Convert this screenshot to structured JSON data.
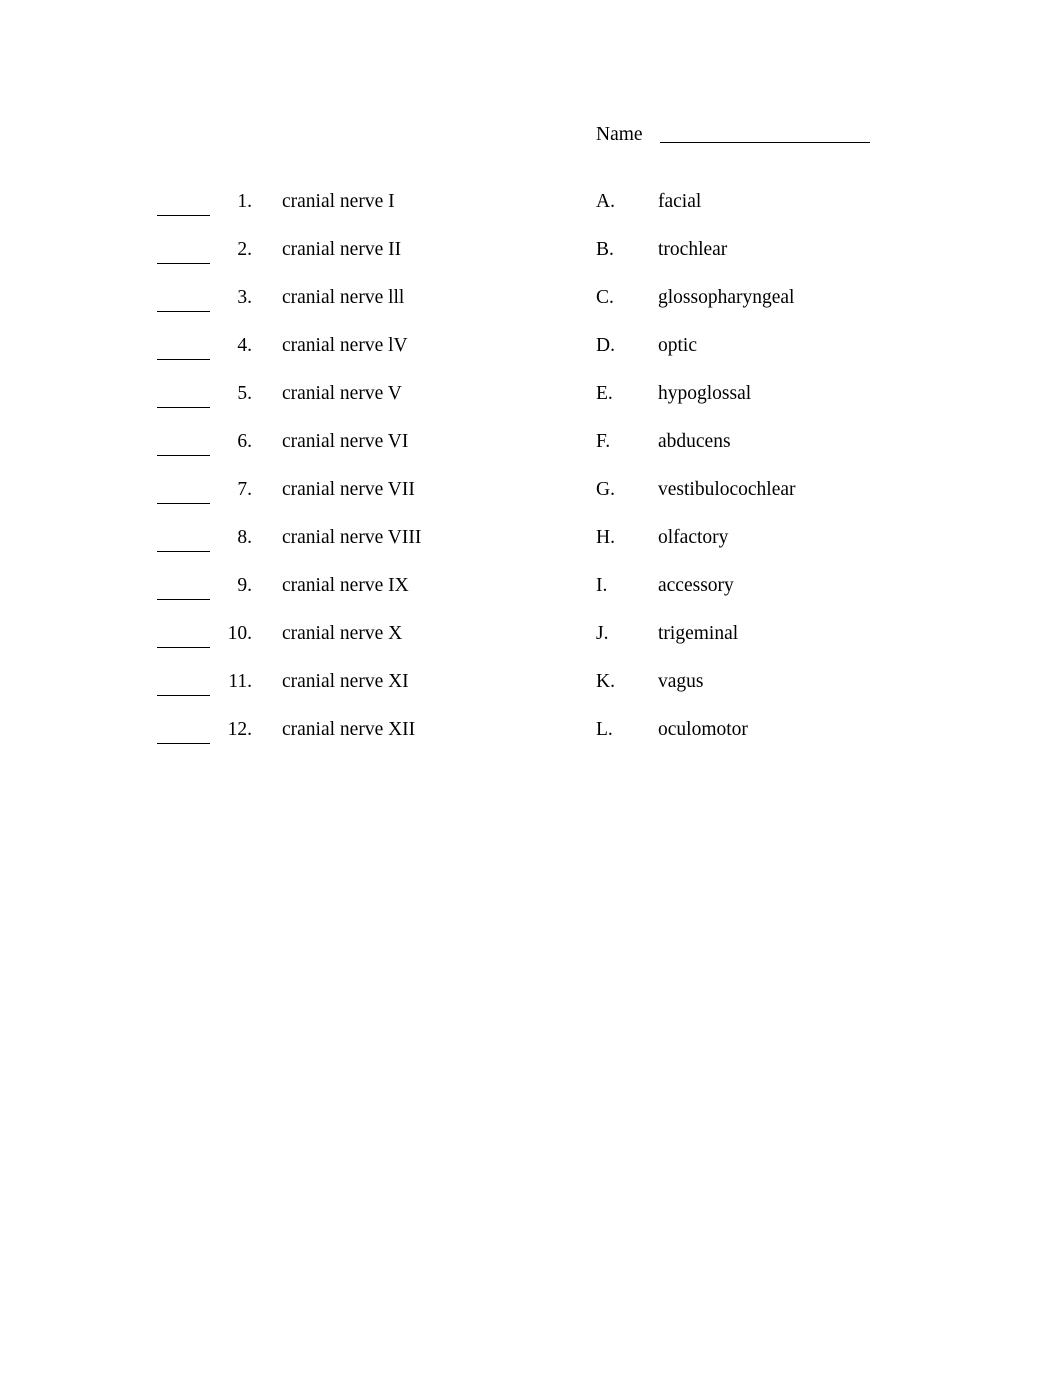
{
  "header": {
    "name_label": "Name"
  },
  "matching": {
    "items": [
      {
        "number": "1.",
        "text": "cranial nerve I"
      },
      {
        "number": "2.",
        "text": "cranial nerve II"
      },
      {
        "number": "3.",
        "text": "cranial nerve lll"
      },
      {
        "number": "4.",
        "text": "cranial nerve lV"
      },
      {
        "number": "5.",
        "text": "cranial nerve V"
      },
      {
        "number": "6.",
        "text": "cranial nerve VI"
      },
      {
        "number": "7.",
        "text": "cranial nerve VII"
      },
      {
        "number": "8.",
        "text": "cranial nerve VIII"
      },
      {
        "number": "9.",
        "text": "cranial nerve IX"
      },
      {
        "number": "10.",
        "text": "cranial nerve X"
      },
      {
        "number": "11.",
        "text": "cranial nerve XI"
      },
      {
        "number": "12.",
        "text": "cranial nerve XII"
      }
    ],
    "options": [
      {
        "letter": "A.",
        "text": "facial"
      },
      {
        "letter": "B.",
        "text": "trochlear"
      },
      {
        "letter": "C.",
        "text": "glossopharyngeal"
      },
      {
        "letter": "D.",
        "text": "optic"
      },
      {
        "letter": "E.",
        "text": "hypoglossal"
      },
      {
        "letter": "F.",
        "text": "abducens"
      },
      {
        "letter": "G.",
        "text": "vestibulocochlear"
      },
      {
        "letter": "H.",
        "text": "olfactory"
      },
      {
        "letter": "I.",
        "text": "accessory"
      },
      {
        "letter": "J.",
        "text": "trigeminal"
      },
      {
        "letter": "K.",
        "text": "vagus"
      },
      {
        "letter": "L.",
        "text": "oculomotor"
      }
    ]
  },
  "colors": {
    "page_background": "#ffffff",
    "text": "#000000",
    "rule": "#000000"
  }
}
